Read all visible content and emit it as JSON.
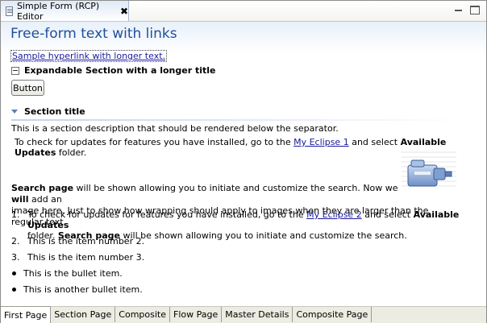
{
  "editor_tab": {
    "title": "Simple Form (RCP) Editor",
    "close": "✖"
  },
  "form": {
    "title": "Free-form text with links",
    "hyperlink": "Sample hyperlink with longer text.",
    "expandable_title": "Expandable Section with a longer title",
    "button_label": "Button",
    "section_title": "Section title",
    "section_description": "This is a section description that should be rendered below the separator.",
    "updates": {
      "prefix": "To check for updates for features you have installed, go to the ",
      "link": "My Eclipse 1",
      "middle": " and select ",
      "bold": "Available Updates",
      "suffix": " folder."
    },
    "search": {
      "bold1": "Search page",
      "text1": " will be shown allowing you to initiate and customize the search. Now we ",
      "bold2": "will",
      "text2": " add an",
      "line2": "image here. Just to show how wrapping should apply to images when they are larger than the regular text."
    },
    "list": [
      {
        "marker": "1.",
        "prefix": "To check for updates for features you have installed, go to the ",
        "link": "My Eclipse 2",
        "middle": " and select ",
        "bold": "Available Updates",
        "line2_text": "folder. ",
        "line2_bold": "Search page",
        "line2_rest": " will be shown allowing you to initiate and customize the search."
      },
      {
        "marker": "2.",
        "text": "This is the item number 2."
      },
      {
        "marker": "3.",
        "text": "This is the item number 3."
      },
      {
        "text": "This is the bullet item."
      },
      {
        "text": "This is another bullet item."
      }
    ]
  },
  "page_tabs": [
    "First Page",
    "Section Page",
    "Composite",
    "Flow Page",
    "Master Details",
    "Composite Page"
  ],
  "icons": {
    "tab": "editor-file-icon",
    "image": "update-manager-image",
    "minimize": "minimize-icon",
    "maximize": "maximize-icon"
  },
  "colors": {
    "title": "#1f4f99",
    "link": "#1a1a9c",
    "section_twistie": "#5b7fb8"
  }
}
